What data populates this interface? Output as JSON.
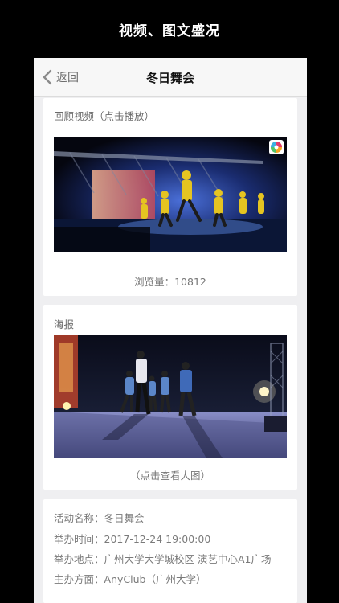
{
  "banner": {
    "title": "视频、图文盛况"
  },
  "navbar": {
    "back_label": "返回",
    "title": "冬日舞会"
  },
  "video_card": {
    "label": "回顾视频（点击播放）",
    "views": "浏览量：10812"
  },
  "poster_card": {
    "label": "海报",
    "hint": "（点击查看大图）"
  },
  "info": {
    "name_key": "活动名称：",
    "name": "冬日舞会",
    "time_key": "举办时间：",
    "time": "2017-12-24 19:00:00",
    "place_key": "举办地点：",
    "place": "广州大学大学城校区 演艺中心A1广场",
    "organizer_key": "主办方面：",
    "organizer": "AnyClub（广州大学）"
  },
  "colors": {
    "page_bg": "#000000",
    "content_bg": "#efeff1",
    "card_bg": "#ffffff",
    "text_gray": "#777777"
  }
}
